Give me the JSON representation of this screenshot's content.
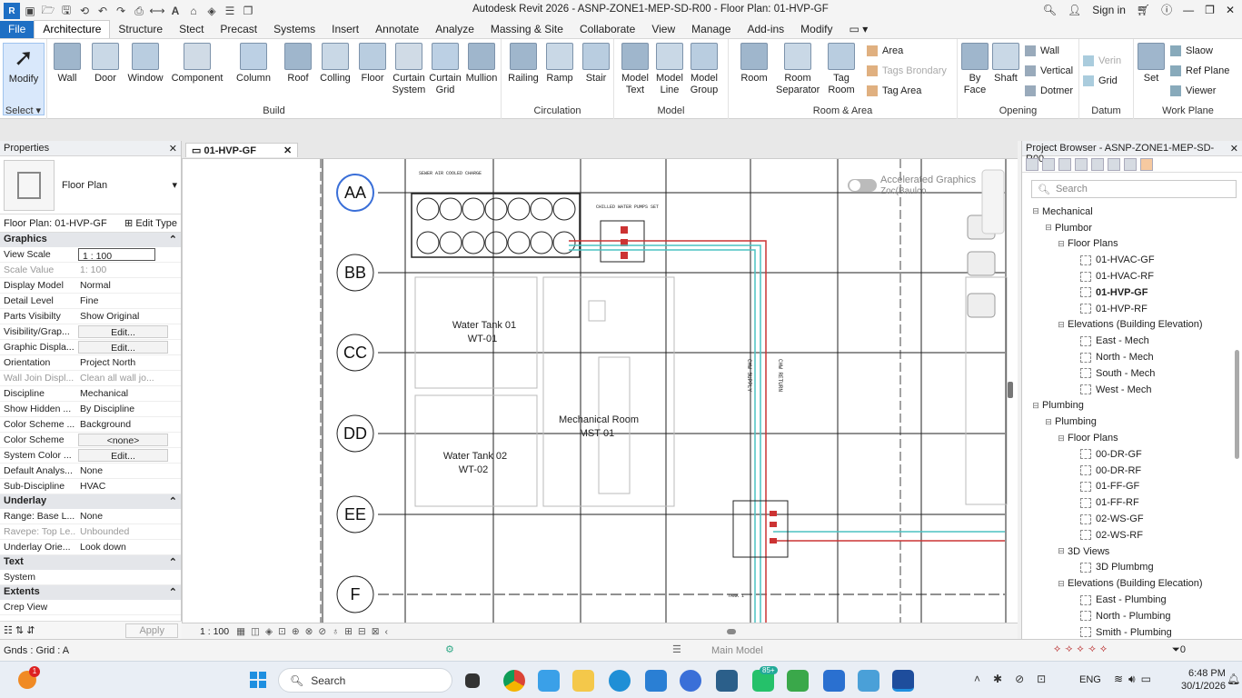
{
  "app": {
    "title": "Autodesk Revit 2026 - ASNP-ZONE1-MEP-SD-R00 - Floor Plan: 01-HVP-GF",
    "sign_in": "Sign in"
  },
  "ribbon_tabs": [
    "File",
    "Architecture",
    "Structure",
    "Stect",
    "Precast",
    "Systems",
    "Insert",
    "Annotate",
    "Analyze",
    "Massing & Site",
    "Collaborate",
    "View",
    "Manage",
    "Add-ins",
    "Modify"
  ],
  "ribbon": {
    "modify": "Modify",
    "select": "Select",
    "build": {
      "title": "Build",
      "buttons": [
        "Wall",
        "Door",
        "Window",
        "Component",
        "Column",
        "Roof",
        "Colling",
        "Floor",
        "Curtain System",
        "Curtain Grid",
        "Mullion"
      ]
    },
    "circulation": {
      "title": "Circulation",
      "buttons": [
        "Railing",
        "Ramp",
        "Stair"
      ]
    },
    "model": {
      "title": "Model",
      "buttons": [
        "Model Text",
        "Model Line",
        "Model Group"
      ]
    },
    "room_area": {
      "title": "Room & Area",
      "buttons": [
        "Room",
        "Room Separator",
        "Tag Room"
      ],
      "small": [
        "Area",
        "Tags Brondary",
        "Tag Area"
      ]
    },
    "opening": {
      "title": "Opening",
      "buttons": [
        "By Face",
        "Shaft"
      ],
      "small": [
        "Wall",
        "Vertical",
        "Dotmer"
      ]
    },
    "datum": {
      "title": "Datum",
      "small": [
        "Verin",
        "Grid"
      ]
    },
    "work_plane": {
      "title": "Work Plane",
      "buttons": [
        "Set"
      ],
      "small": [
        "Slaow",
        "Ref Plane",
        "Viewer"
      ]
    }
  },
  "properties": {
    "header": "Properties",
    "type_name": "Floor Plan",
    "instance": "Floor Plan: 01-HVP-GF",
    "edit_type": "Edit Type",
    "groups": [
      {
        "name": "Graphics",
        "rows": [
          {
            "k": "View Scale",
            "v": "1 : 100"
          },
          {
            "k": "Scale Value",
            "v": "1: 100",
            "dis": true
          },
          {
            "k": "Display Model",
            "v": "Normal"
          },
          {
            "k": "Detail Level",
            "v": "Fine"
          },
          {
            "k": "Parts Visibilty",
            "v": "Show Original"
          },
          {
            "k": "Visibility/Grap...",
            "v": "Edit...",
            "btn": true
          },
          {
            "k": "Graphic Displa...",
            "v": "Edit...",
            "btn": true
          },
          {
            "k": "Orientation",
            "v": "Project North"
          },
          {
            "k": "Wall Join Displ...",
            "v": "Clean all wall jo...",
            "dis": true
          },
          {
            "k": "Discipline",
            "v": "Mechanical"
          },
          {
            "k": "Show Hidden ...",
            "v": "By Discipline"
          },
          {
            "k": "Color Scheme ...",
            "v": "Background"
          },
          {
            "k": "Color Scheme",
            "v": "<none>",
            "btn": true
          },
          {
            "k": "System Color ...",
            "v": "Edit...",
            "btn": true
          },
          {
            "k": "Default Analys...",
            "v": "None"
          },
          {
            "k": "Sub-Discipline",
            "v": "HVAC"
          }
        ]
      },
      {
        "name": "Underlay",
        "rows": [
          {
            "k": "Range: Base L...",
            "v": "None"
          },
          {
            "k": "Ravepe: Top Le...",
            "v": "Unbounded",
            "dis": true
          },
          {
            "k": "Underlay Orie...",
            "v": "Look down"
          }
        ]
      },
      {
        "name": "Text",
        "rows": [
          {
            "k": "System",
            "v": ""
          }
        ]
      },
      {
        "name": "Extents",
        "rows": [
          {
            "k": "Crep View",
            "v": ""
          }
        ]
      }
    ],
    "apply": "Apply"
  },
  "view": {
    "tab": "01-HVP-GF",
    "accel": "Accelerated Graphics",
    "accel_sub": "Zoc(Baulco",
    "scale": "1 : 100",
    "grid_labels": [
      "A",
      "B",
      "C",
      "D",
      "E",
      "F"
    ],
    "rooms": [
      {
        "name": "Water Tank 01",
        "num": "WT-01"
      },
      {
        "name": "Water Tank 02",
        "num": "WT-02"
      },
      {
        "name": "Mechanical Room",
        "num": "MST-01"
      }
    ],
    "notes": [
      "SEWER AIR COOLED CHARGE",
      "CHILLED WATER PUMPS SET",
      "TANK 1"
    ]
  },
  "browser": {
    "header": "Project Browser - ASNP-ZONE1-MEP-SD-R00",
    "search": "Search",
    "tree": [
      {
        "l": 0,
        "t": "Mechanical",
        "tg": "−"
      },
      {
        "l": 1,
        "t": "Plumbor",
        "tg": "−"
      },
      {
        "l": 2,
        "t": "Floor Plans",
        "tg": "−"
      },
      {
        "l": 3,
        "t": "01-HVAC-GF",
        "v": true
      },
      {
        "l": 3,
        "t": "01-HVAC-RF",
        "v": true
      },
      {
        "l": 3,
        "t": "01-HVP-GF",
        "v": true,
        "cur": true
      },
      {
        "l": 3,
        "t": "01-HVP-RF",
        "v": true
      },
      {
        "l": 2,
        "t": "Elevations (Building Elevation)",
        "tg": "−"
      },
      {
        "l": 3,
        "t": "East - Mech",
        "v": true
      },
      {
        "l": 3,
        "t": "North - Mech",
        "v": true
      },
      {
        "l": 3,
        "t": "South - Mech",
        "v": true
      },
      {
        "l": 3,
        "t": "West - Mech",
        "v": true
      },
      {
        "l": 0,
        "t": "Plumbing",
        "tg": "−"
      },
      {
        "l": 1,
        "t": "Plumbing",
        "tg": "−"
      },
      {
        "l": 2,
        "t": "Floor Plans",
        "tg": "−"
      },
      {
        "l": 3,
        "t": "00-DR-GF",
        "v": true
      },
      {
        "l": 3,
        "t": "00-DR-RF",
        "v": true
      },
      {
        "l": 3,
        "t": "01-FF-GF",
        "v": true
      },
      {
        "l": 3,
        "t": "01-FF-RF",
        "v": true
      },
      {
        "l": 3,
        "t": "02-WS-GF",
        "v": true
      },
      {
        "l": 3,
        "t": "02-WS-RF",
        "v": true
      },
      {
        "l": 2,
        "t": "3D Views",
        "tg": "−"
      },
      {
        "l": 3,
        "t": "3D Plumbmg",
        "v": true
      },
      {
        "l": 2,
        "t": "Elevations (Building Elecation)",
        "tg": "−"
      },
      {
        "l": 3,
        "t": "East - Plumbing",
        "v": true
      },
      {
        "l": 3,
        "t": "North - Plumbing",
        "v": true
      },
      {
        "l": 3,
        "t": "Smith - Plumbing",
        "v": true
      }
    ]
  },
  "status": {
    "left": "Gnds : Grid : A",
    "model": "Main Model",
    "filter": "0"
  },
  "taskbar": {
    "search": "Search",
    "lang": "ENG",
    "time": "6:48 PM",
    "date": "30/1/2026",
    "badge": "1",
    "badge2": "85+"
  }
}
